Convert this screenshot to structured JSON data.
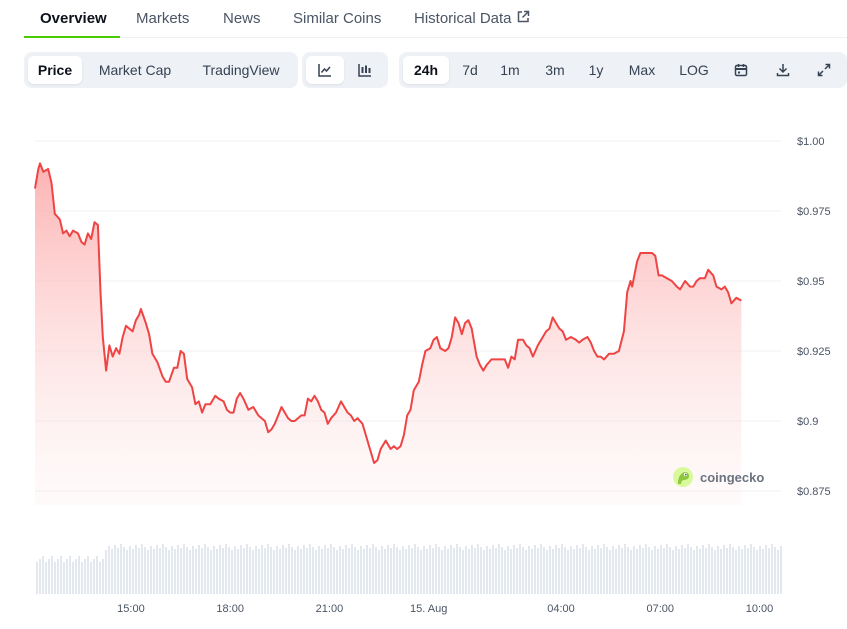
{
  "nav": {
    "tabs": [
      {
        "label": "Overview",
        "active": true
      },
      {
        "label": "Markets"
      },
      {
        "label": "News"
      },
      {
        "label": "Similar Coins"
      },
      {
        "label": "Historical Data",
        "icon": "external-link-icon"
      }
    ]
  },
  "toolbar": {
    "chart_kind": [
      "Price",
      "Market Cap",
      "TradingView"
    ],
    "active_kind": "Price",
    "chart_style_icons": [
      "line-chart-icon",
      "candlestick-chart-icon"
    ],
    "ranges": [
      "24h",
      "7d",
      "1m",
      "3m",
      "1y",
      "Max",
      "LOG"
    ],
    "active_range": "24h",
    "action_icons": [
      "calendar-icon",
      "download-icon",
      "fullscreen-icon"
    ]
  },
  "watermark": {
    "text": "coingecko",
    "icon": "coingecko-logo-icon"
  },
  "colors": {
    "accent": "#4bcc00",
    "line": "#ef4444",
    "area_top": "#fca5a5",
    "volume": "#e3e8ef",
    "grid": "#eef2f6"
  },
  "chart_data": {
    "type": "area",
    "ylim": [
      0.87,
      1.0
    ],
    "ytick_values": [
      1.0,
      0.975,
      0.95,
      0.925,
      0.9,
      0.875
    ],
    "ytick_labels": [
      "$1.00",
      "$0.975",
      "$0.95",
      "$0.925",
      "$0.9",
      "$0.875"
    ],
    "xlim": [
      12.1,
      34.65
    ],
    "xticks": [
      {
        "x": 15,
        "label": "15:00"
      },
      {
        "x": 18,
        "label": "18:00"
      },
      {
        "x": 21,
        "label": "21:00"
      },
      {
        "x": 24,
        "label": "15. Aug"
      },
      {
        "x": 28,
        "label": "04:00"
      },
      {
        "x": 31,
        "label": "07:00"
      },
      {
        "x": 34,
        "label": "10:00"
      }
    ],
    "series": [
      {
        "values": [
          [
            12.1,
            0.983
          ],
          [
            12.2,
            0.99
          ],
          [
            12.25,
            0.992
          ],
          [
            12.35,
            0.989
          ],
          [
            12.5,
            0.99
          ],
          [
            12.6,
            0.985
          ],
          [
            12.7,
            0.974
          ],
          [
            12.85,
            0.972
          ],
          [
            12.95,
            0.967
          ],
          [
            13.05,
            0.968
          ],
          [
            13.15,
            0.966
          ],
          [
            13.25,
            0.968
          ],
          [
            13.4,
            0.967
          ],
          [
            13.5,
            0.964
          ],
          [
            13.6,
            0.963
          ],
          [
            13.7,
            0.967
          ],
          [
            13.8,
            0.965
          ],
          [
            13.9,
            0.971
          ],
          [
            14.0,
            0.97
          ],
          [
            14.08,
            0.946
          ],
          [
            14.15,
            0.93
          ],
          [
            14.25,
            0.918
          ],
          [
            14.35,
            0.927
          ],
          [
            14.45,
            0.923
          ],
          [
            14.55,
            0.926
          ],
          [
            14.65,
            0.924
          ],
          [
            14.75,
            0.93
          ],
          [
            14.85,
            0.934
          ],
          [
            14.95,
            0.933
          ],
          [
            15.05,
            0.932
          ],
          [
            15.15,
            0.936
          ],
          [
            15.25,
            0.938
          ],
          [
            15.3,
            0.94
          ],
          [
            15.45,
            0.935
          ],
          [
            15.55,
            0.931
          ],
          [
            15.65,
            0.924
          ],
          [
            15.8,
            0.921
          ],
          [
            15.95,
            0.916
          ],
          [
            16.05,
            0.914
          ],
          [
            16.15,
            0.914
          ],
          [
            16.3,
            0.919
          ],
          [
            16.4,
            0.919
          ],
          [
            16.5,
            0.925
          ],
          [
            16.6,
            0.924
          ],
          [
            16.7,
            0.915
          ],
          [
            16.85,
            0.912
          ],
          [
            16.95,
            0.906
          ],
          [
            17.05,
            0.907
          ],
          [
            17.15,
            0.903
          ],
          [
            17.25,
            0.906
          ],
          [
            17.4,
            0.906
          ],
          [
            17.55,
            0.909
          ],
          [
            17.65,
            0.908
          ],
          [
            17.8,
            0.907
          ],
          [
            17.9,
            0.904
          ],
          [
            18.0,
            0.903
          ],
          [
            18.1,
            0.903
          ],
          [
            18.2,
            0.908
          ],
          [
            18.3,
            0.91
          ],
          [
            18.4,
            0.908
          ],
          [
            18.55,
            0.904
          ],
          [
            18.7,
            0.905
          ],
          [
            18.85,
            0.902
          ],
          [
            18.95,
            0.901
          ],
          [
            19.05,
            0.9
          ],
          [
            19.15,
            0.896
          ],
          [
            19.25,
            0.897
          ],
          [
            19.35,
            0.899
          ],
          [
            19.45,
            0.902
          ],
          [
            19.55,
            0.905
          ],
          [
            19.65,
            0.903
          ],
          [
            19.75,
            0.901
          ],
          [
            19.85,
            0.9
          ],
          [
            19.95,
            0.9
          ],
          [
            20.05,
            0.901
          ],
          [
            20.15,
            0.902
          ],
          [
            20.25,
            0.902
          ],
          [
            20.35,
            0.908
          ],
          [
            20.45,
            0.907
          ],
          [
            20.55,
            0.909
          ],
          [
            20.65,
            0.907
          ],
          [
            20.75,
            0.904
          ],
          [
            20.85,
            0.903
          ],
          [
            20.95,
            0.899
          ],
          [
            21.05,
            0.901
          ],
          [
            21.2,
            0.903
          ],
          [
            21.35,
            0.907
          ],
          [
            21.45,
            0.905
          ],
          [
            21.55,
            0.903
          ],
          [
            21.65,
            0.902
          ],
          [
            21.75,
            0.9
          ],
          [
            21.85,
            0.901
          ],
          [
            22.0,
            0.899
          ],
          [
            22.1,
            0.895
          ],
          [
            22.2,
            0.891
          ],
          [
            22.35,
            0.885
          ],
          [
            22.45,
            0.886
          ],
          [
            22.55,
            0.89
          ],
          [
            22.7,
            0.893
          ],
          [
            22.85,
            0.89
          ],
          [
            22.95,
            0.891
          ],
          [
            23.05,
            0.89
          ],
          [
            23.15,
            0.891
          ],
          [
            23.25,
            0.895
          ],
          [
            23.35,
            0.902
          ],
          [
            23.45,
            0.904
          ],
          [
            23.55,
            0.911
          ],
          [
            23.7,
            0.914
          ],
          [
            23.8,
            0.92
          ],
          [
            23.9,
            0.925
          ],
          [
            24.05,
            0.926
          ],
          [
            24.15,
            0.929
          ],
          [
            24.25,
            0.93
          ],
          [
            24.35,
            0.926
          ],
          [
            24.5,
            0.925
          ],
          [
            24.6,
            0.926
          ],
          [
            24.7,
            0.93
          ],
          [
            24.8,
            0.937
          ],
          [
            24.9,
            0.935
          ],
          [
            25.0,
            0.931
          ],
          [
            25.1,
            0.935
          ],
          [
            25.2,
            0.936
          ],
          [
            25.3,
            0.933
          ],
          [
            25.45,
            0.923
          ],
          [
            25.55,
            0.92
          ],
          [
            25.65,
            0.918
          ],
          [
            25.75,
            0.92
          ],
          [
            25.9,
            0.922
          ],
          [
            26.05,
            0.922
          ],
          [
            26.15,
            0.922
          ],
          [
            26.3,
            0.922
          ],
          [
            26.4,
            0.919
          ],
          [
            26.5,
            0.923
          ],
          [
            26.6,
            0.922
          ],
          [
            26.7,
            0.929
          ],
          [
            26.85,
            0.929
          ],
          [
            26.95,
            0.927
          ],
          [
            27.05,
            0.926
          ],
          [
            27.15,
            0.923
          ],
          [
            27.3,
            0.927
          ],
          [
            27.45,
            0.93
          ],
          [
            27.55,
            0.932
          ],
          [
            27.65,
            0.933
          ],
          [
            27.75,
            0.937
          ],
          [
            27.85,
            0.935
          ],
          [
            27.95,
            0.933
          ],
          [
            28.05,
            0.932
          ],
          [
            28.15,
            0.929
          ],
          [
            28.3,
            0.93
          ],
          [
            28.45,
            0.929
          ],
          [
            28.55,
            0.928
          ],
          [
            28.65,
            0.929
          ],
          [
            28.8,
            0.93
          ],
          [
            28.9,
            0.928
          ],
          [
            29.0,
            0.925
          ],
          [
            29.1,
            0.923
          ],
          [
            29.2,
            0.923
          ],
          [
            29.3,
            0.922
          ],
          [
            29.45,
            0.924
          ],
          [
            29.6,
            0.924
          ],
          [
            29.75,
            0.925
          ],
          [
            29.9,
            0.932
          ],
          [
            30.0,
            0.946
          ],
          [
            30.1,
            0.95
          ],
          [
            30.15,
            0.948
          ],
          [
            30.2,
            0.951
          ],
          [
            30.3,
            0.957
          ],
          [
            30.4,
            0.96
          ],
          [
            30.5,
            0.96
          ],
          [
            30.6,
            0.96
          ],
          [
            30.75,
            0.96
          ],
          [
            30.85,
            0.959
          ],
          [
            30.95,
            0.952
          ],
          [
            31.05,
            0.952
          ],
          [
            31.2,
            0.951
          ],
          [
            31.35,
            0.95
          ],
          [
            31.5,
            0.948
          ],
          [
            31.6,
            0.947
          ],
          [
            31.75,
            0.95
          ],
          [
            31.9,
            0.948
          ],
          [
            32.0,
            0.948
          ],
          [
            32.1,
            0.95
          ],
          [
            32.2,
            0.951
          ],
          [
            32.35,
            0.951
          ],
          [
            32.45,
            0.954
          ],
          [
            32.6,
            0.952
          ],
          [
            32.7,
            0.948
          ],
          [
            32.85,
            0.947
          ],
          [
            32.95,
            0.948
          ],
          [
            33.05,
            0.946
          ],
          [
            33.15,
            0.942
          ],
          [
            33.3,
            0.944
          ],
          [
            33.45,
            0.943
          ]
        ]
      }
    ]
  }
}
